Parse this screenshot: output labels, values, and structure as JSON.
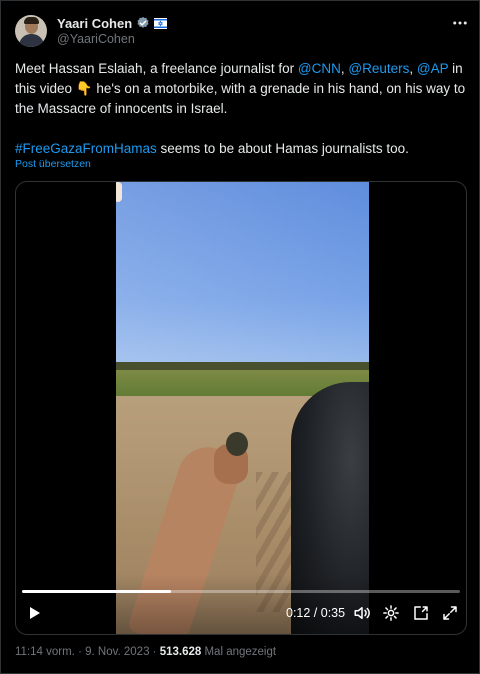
{
  "author": {
    "display_name": "Yaari Cohen",
    "handle": "@YaariCohen"
  },
  "tweet": {
    "line1_prefix": "Meet Hassan Eslaiah, a freelance journalist for ",
    "mention1": "@CNN",
    "sep1": ", ",
    "mention2": "@Reuters",
    "sep2": ", ",
    "mention3": "@AP",
    "line1_suffix": " in this video 👇 he's on a motorbike, with a grenade in his hand, on his way to the Massacre of innocents in Israel.",
    "hashtag": "#FreeGazaFromHamas",
    "line2_suffix": " seems to be about Hamas journalists too.",
    "translate_label": "Post übersetzen"
  },
  "video": {
    "time_display": "0:12 / 0:35",
    "progress_fraction": 0.34
  },
  "meta": {
    "time": "11:14 vorm.",
    "sep": " · ",
    "date": "9. Nov. 2023",
    "dot": " · ",
    "views": "513.628",
    "views_label": " Mal angezeigt"
  },
  "colors": {
    "accent": "#1d9bf0",
    "text": "#e7e9ea",
    "muted": "#71767b",
    "background": "#000000"
  }
}
